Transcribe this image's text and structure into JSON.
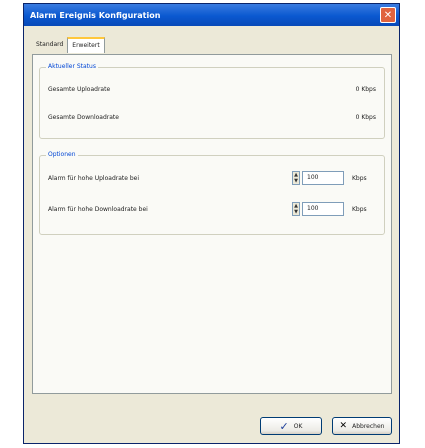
{
  "window": {
    "title": "Alarm Ereignis Konfiguration",
    "close_glyph": "✕"
  },
  "tabs": [
    {
      "label": "Standard",
      "active": false
    },
    {
      "label": "Erweitert",
      "active": true
    }
  ],
  "status": {
    "title": "Aktueller Status",
    "upload_label": "Gesamte Uploadrate",
    "upload_value": "0 Kbps",
    "download_label": "Gesamte Downloadrate",
    "download_value": "0 Kbps"
  },
  "options": {
    "title": "Optionen",
    "alarm_upload_label": "Alarm für hohe Uploadrate bei",
    "alarm_upload_value": "100",
    "alarm_upload_unit": "Kbps",
    "alarm_download_label": "Alarm für hohe Downloadrate bei",
    "alarm_download_value": "100",
    "alarm_download_unit": "Kbps"
  },
  "footer": {
    "ok_label": "OK",
    "cancel_label": "Abbrechen"
  },
  "colors": {
    "title_bar": "#0A58D0",
    "window_bg": "#ECE9D8",
    "group_title": "#0046D5"
  }
}
